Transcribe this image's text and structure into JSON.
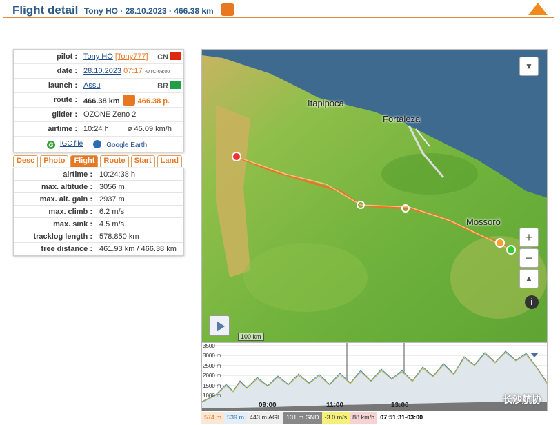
{
  "header": {
    "title": "Flight detail",
    "subtitle": "Tony HO · 28.10.2023 · 466.38 km"
  },
  "info": {
    "pilot_label": "pilot :",
    "pilot_name": "Tony HO",
    "pilot_handle": "[Tony777]",
    "pilot_country": "CN",
    "date_label": "date :",
    "date_value": "28.10.2023",
    "time_value": "07:17",
    "tz_value": "-UTC-03:00",
    "launch_label": "launch :",
    "launch_value": "Assu",
    "launch_country": "BR",
    "route_label": "route :",
    "route_km": "466.38 km",
    "route_points": "466.38 p.",
    "glider_label": "glider :",
    "glider_value": "OZONE Zeno 2",
    "airtime_label": "airtime :",
    "airtime_value": "10:24 h",
    "speed_value": "ø 45.09 km/h",
    "igc_label": "IGC file",
    "earth_label": "Google Earth"
  },
  "tabs": [
    "Desc",
    "Photo",
    "Flight",
    "Route",
    "Start",
    "Land"
  ],
  "stats": [
    {
      "label": "airtime :",
      "value": "10:24:38 h"
    },
    {
      "label": "max. altitude :",
      "value": "3056 m"
    },
    {
      "label": "max. alt. gain :",
      "value": "2937 m"
    },
    {
      "label": "max. climb :",
      "value": "6.2 m/s"
    },
    {
      "label": "max. sink :",
      "value": "4.5 m/s"
    },
    {
      "label": "tracklog length :",
      "value": "578.850 km"
    },
    {
      "label": "free distance :",
      "value": "461.93 km / 466.38 km"
    }
  ],
  "map": {
    "cities": [
      "Itapipoca",
      "Fortaleza",
      "Mossoró"
    ],
    "scale_label": "100 km",
    "zoom_in": "+",
    "zoom_out": "−",
    "info": "i"
  },
  "graph": {
    "y_labels": [
      "3500",
      "3000 m",
      "2500 m",
      "2000 m",
      "1500 m",
      "1000 m"
    ],
    "x_labels": [
      "09:00",
      "11:00",
      "13:00"
    ],
    "watermark": "长沙航协"
  },
  "readout": {
    "alt_msl": "574 m",
    "alt_gps": "539 m",
    "agl": "443 m AGL",
    "gnd": "131 m GND",
    "vario": "-3.0 m/s",
    "speed": "88 km/h",
    "time": "07:51:31-03:00"
  },
  "colors": {
    "accent": "#e87722",
    "title_blue": "#2a5a8a",
    "sea": "#3d6a8e",
    "track": "#e87722"
  }
}
